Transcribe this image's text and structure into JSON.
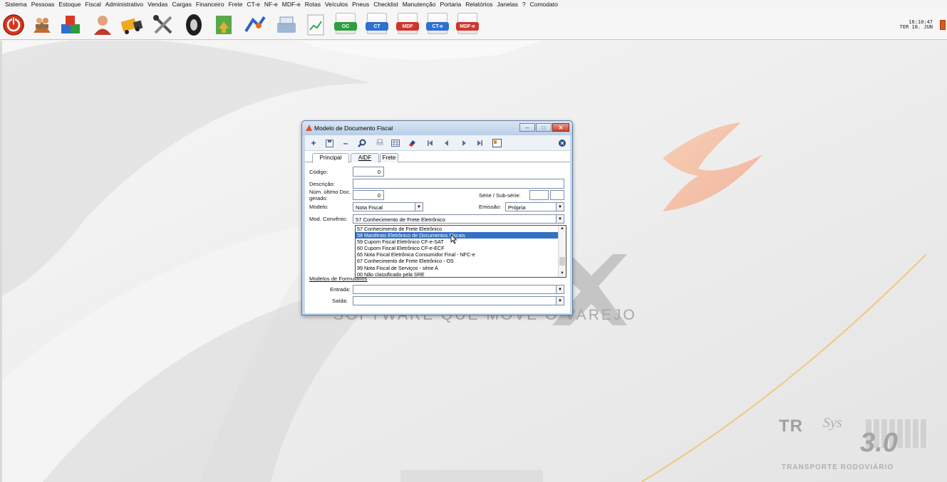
{
  "menu": [
    "Sistema",
    "Pessoas",
    "Estoque",
    "Fiscal",
    "Administrativo",
    "Vendas",
    "Cargas",
    "Financeiro",
    "Frete",
    "CT-e",
    "NF-e",
    "MDF-e",
    "Rotas",
    "Veículos",
    "Pneus",
    "Checklist",
    "Manutenção",
    "Portaria",
    "Relatórios",
    "Janelas",
    "?",
    "Comodato"
  ],
  "toolbar": {
    "doc_buttons": [
      {
        "label": "OC",
        "color": "#2e9e3e"
      },
      {
        "label": "CT",
        "color": "#2f6fd0"
      },
      {
        "label": "MDF",
        "color": "#d0342c"
      },
      {
        "label": "CT-e",
        "color": "#2f6fd0"
      },
      {
        "label": "MDF-e",
        "color": "#d0342c"
      }
    ]
  },
  "clock": {
    "time": "16:10:47",
    "date": "TER 18. JUN"
  },
  "background": {
    "tagline": "SOFTWARE QUE MOVE O VAREJO",
    "brand": {
      "tr": "TR",
      "sys": "Sys",
      "version": "3.0",
      "subtitle": "TRANSPORTE RODOVIÁRIO"
    }
  },
  "dialog": {
    "title": "Modelo de Documento Fiscal",
    "tabs": {
      "principal": "Principal",
      "aidf": "AIDF",
      "frete": "Frete"
    },
    "labels": {
      "codigo": "Código:",
      "descricao": "Descrição:",
      "num_ultimo_1": "Núm. último Doc.",
      "num_ultimo_2": "gerado:",
      "serie": "Série / Sub-série:",
      "modelo": "Modelo:",
      "emissao": "Emissão:",
      "mod_convenio": "Mod. Convênio:",
      "modelos_formularios": "Modelos de Formulários",
      "entrada": "Entrada:",
      "saida": "Saída:"
    },
    "values": {
      "codigo": "0",
      "descricao": "",
      "num_ultimo": "0",
      "serie": "",
      "subserie": "",
      "modelo": "Nota Fiscal",
      "emissao": "Própria",
      "mod_convenio": "57 Conhecimento de Frete Eletrônico",
      "entrada": "",
      "saida": ""
    },
    "dropdown_options": [
      "57 Conhecimento de Frete Eletrônico",
      "58 Manifesto Eletrônico de Documentos Fiscais",
      "59 Cupom Fiscal Eletrônico CF-e-SAT",
      "60 Cupom Fiscal Eletrônico CF-e-ECF",
      "65 Nota Fiscal Eletrônica Consumidor Final - NFC-e",
      "67 Conhecimento de Frete Eletrônico - OS",
      "99 Nota Fiscal de Serviços - série A",
      "00 Não classificado pela SRE"
    ],
    "dropdown_selected_index": 1
  }
}
